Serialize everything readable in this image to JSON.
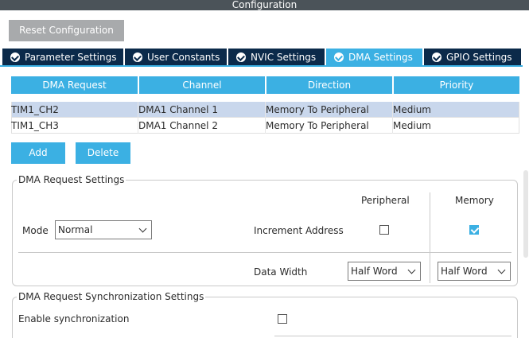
{
  "window": {
    "title": "Configuration"
  },
  "toolbar": {
    "reset_label": "Reset Configuration"
  },
  "tabs": [
    {
      "label": "Parameter Settings",
      "active": false
    },
    {
      "label": "User Constants",
      "active": false
    },
    {
      "label": "NVIC Settings",
      "active": false
    },
    {
      "label": "DMA Settings",
      "active": true
    },
    {
      "label": "GPIO Settings",
      "active": false
    }
  ],
  "dma_table": {
    "headers": [
      "DMA Request",
      "Channel",
      "Direction",
      "Priority"
    ],
    "rows": [
      [
        "TIM1_CH2",
        "DMA1 Channel 1",
        "Memory To Peripheral",
        "Medium"
      ],
      [
        "TIM1_CH3",
        "DMA1 Channel 2",
        "Memory To Peripheral",
        "Medium"
      ]
    ],
    "selected_row": 0
  },
  "actions": {
    "add_label": "Add",
    "delete_label": "Delete"
  },
  "request_settings": {
    "title": "DMA Request Settings",
    "peripheral_label": "Peripheral",
    "memory_label": "Memory",
    "mode_label": "Mode",
    "mode_value": "Normal",
    "increment_label": "Increment Address",
    "increment_peripheral": false,
    "increment_memory": true,
    "data_width_label": "Data Width",
    "peripheral_width": "Half Word",
    "memory_width": "Half Word"
  },
  "sync_settings": {
    "title": "DMA Request Synchronization Settings",
    "enable_label": "Enable synchronization",
    "enabled": false
  },
  "colors": {
    "accent": "#3bb0e3",
    "tab_dark": "#0b2a4a",
    "selected_row": "#c9d7ec"
  }
}
